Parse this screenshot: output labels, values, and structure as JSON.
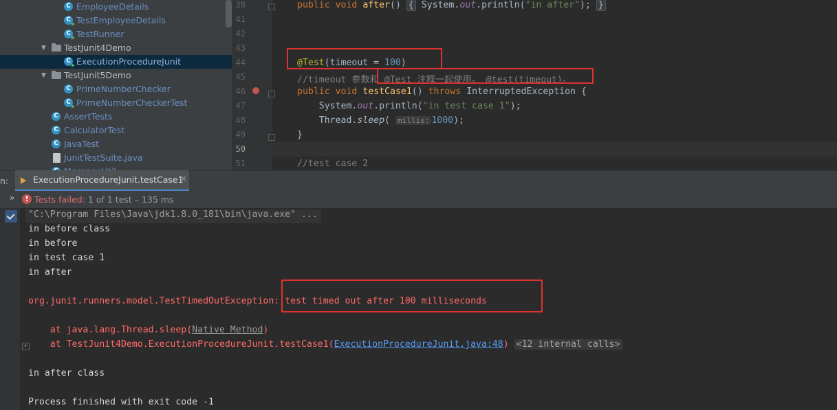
{
  "project_tree": {
    "items": [
      {
        "label": "EmployeeDetails",
        "type": "class"
      },
      {
        "label": "TestEmployeeDetails",
        "type": "test-class"
      },
      {
        "label": "TestRunner",
        "type": "test-class"
      },
      {
        "label": "TestJunit4Demo",
        "type": "package"
      },
      {
        "label": "ExecutionProcedureJunit",
        "type": "test-class",
        "selected": true
      },
      {
        "label": "TestJunit5Demo",
        "type": "package"
      },
      {
        "label": "PrimeNumberChecker",
        "type": "class"
      },
      {
        "label": "PrimeNumberCheckerTest",
        "type": "test-class"
      },
      {
        "label": "AssertTests",
        "type": "class"
      },
      {
        "label": "CalculatorTest",
        "type": "class"
      },
      {
        "label": "JavaTest",
        "type": "class"
      },
      {
        "label": "JunitTestSuite.java",
        "type": "file"
      },
      {
        "label": "MessageUtil",
        "type": "class"
      }
    ]
  },
  "editor": {
    "line_numbers": [
      "38",
      "41",
      "42",
      "43",
      "44",
      "45",
      "46",
      "47",
      "48",
      "49",
      "50",
      "51"
    ],
    "line38": {
      "kw1": "public",
      "kw2": "void",
      "fn": "after",
      "parens": "()",
      "ob": "{",
      "sys": "System.",
      "out": "out",
      "println": ".println(",
      "str": "\"in after\"",
      "end": ");",
      "cb": "}"
    },
    "line44": {
      "ann": "@Test",
      "open": "(timeout = ",
      "num": "100",
      "close": ")"
    },
    "line45": {
      "comment1": "//timeout 参数和",
      "comment2": " @Test 注释一起使用。 @test(timeout)。"
    },
    "line46": {
      "kw1": "public",
      "kw2": "void",
      "fn": "testCase1",
      "parens": "() ",
      "throws": "throws",
      "exc": " InterruptedException {"
    },
    "line47": {
      "sys": "System.",
      "out": "out",
      "println": ".println(",
      "str": "\"in test case 1\"",
      "end": ");"
    },
    "line48": {
      "thread": "Thread.",
      "sleep": "sleep",
      "open": "(",
      "hint": "millis:",
      "num": "1000",
      "end": ");"
    },
    "line49": {
      "brace": "}"
    },
    "line51": {
      "comment": "//test case 2"
    }
  },
  "run_panel": {
    "label": "n:",
    "tab_title": "ExecutionProcedureJunit.testCase1",
    "close_glyph": "×",
    "chevrons": "»",
    "status_fail": "Tests failed:",
    "status_detail": " 1 of 1 test – 135 ms",
    "console": {
      "cmd": "\"C:\\Program Files\\Java\\jdk1.8.0_181\\bin\\java.exe\" ...",
      "line1": "in before class",
      "line2": "in before",
      "line3": "in test case 1",
      "line4": "in after",
      "exception": "org.junit.runners.model.TestTimedOutException: test timed out after 100 milliseconds",
      "trace1_prefix": "    at java.lang.Thread.sleep(",
      "trace1_link": "Native Method",
      "trace1_suffix": ")",
      "trace2_prefix": "    at TestJunit4Demo.ExecutionProcedureJunit.testCase1(",
      "trace2_link": "ExecutionProcedureJunit.java:48",
      "trace2_suffix": ")",
      "internal_calls": "<12 internal calls>",
      "line5": "in after class",
      "finish": "Process finished with exit code -1"
    }
  },
  "colors": {
    "accent": "#4a88c7",
    "error": "#ff6b68",
    "highlight_box": "#e0312f"
  }
}
